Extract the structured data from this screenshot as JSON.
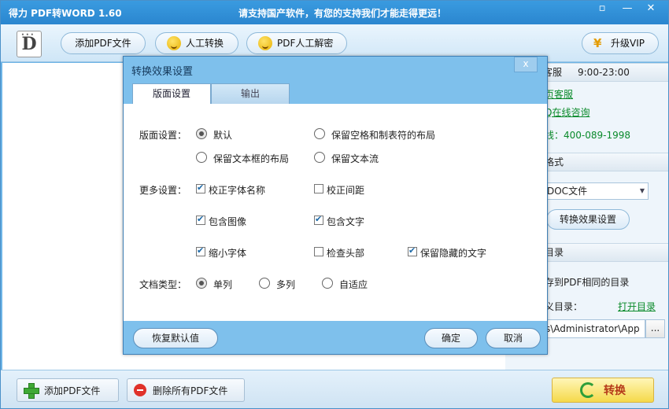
{
  "window": {
    "app_title": "得力 PDF转WORD 1.60",
    "slogan": "请支持国产软件，有您的支持我们才能走得更远！",
    "controls": [
      "▫",
      "—",
      "✕"
    ]
  },
  "toolbar": {
    "logo_letter": "D",
    "add_pdf_label": "添加PDF文件",
    "manual_convert_label": "人工转换",
    "pdf_decrypt_label": "PDF人工解密",
    "upgrade_vip_label": "升级VIP",
    "vip_icon": "¥"
  },
  "right_panel": {
    "service_label": "客服",
    "service_hours": "9:00-23:00",
    "web_service_link": "页客服",
    "qq_link": "Q在线咨询",
    "hotline": "线：400-089-1998",
    "format_header": "格式",
    "format_select": "DOC文件",
    "convert_settings_button": "转换效果设置",
    "dir_header": "目录",
    "save_same_dir": "存到PDF相同的目录",
    "custom_dir_label": "义目录：",
    "open_dir_link": "打开目录",
    "path_value": "s\\Administrator\\App",
    "browse_button": "..."
  },
  "bottom": {
    "add_pdf_label": "添加PDF文件",
    "delete_all_label": "删除所有PDF文件",
    "convert_label": "转换"
  },
  "dialog": {
    "title": "转换效果设置",
    "close": "x",
    "tabs": [
      {
        "label": "版面设置",
        "active": true
      },
      {
        "label": "输出",
        "active": false
      }
    ],
    "layout_label": "版面设置：",
    "layout_options": [
      {
        "label": "默认",
        "selected": true
      },
      {
        "label": "保留空格和制表符的布局",
        "selected": false
      },
      {
        "label": "保留文本框的布局",
        "selected": false
      },
      {
        "label": "保留文本流",
        "selected": false
      }
    ],
    "more_label": "更多设置：",
    "more_options": [
      {
        "label": "校正字体名称",
        "checked": true
      },
      {
        "label": "校正间距",
        "checked": false
      },
      {
        "label": "包含图像",
        "checked": true
      },
      {
        "label": "包含文字",
        "checked": true
      },
      {
        "label": "缩小字体",
        "checked": true
      },
      {
        "label": "检查头部",
        "checked": false
      },
      {
        "label": "保留隐藏的文字",
        "checked": true
      }
    ],
    "doctype_label": "文档类型：",
    "doctype_options": [
      {
        "label": "单列",
        "selected": true
      },
      {
        "label": "多列",
        "selected": false
      },
      {
        "label": "自适应",
        "selected": false
      }
    ],
    "restore_default": "恢复默认值",
    "ok": "确定",
    "cancel": "取消"
  },
  "colors": {
    "title_bar": "#2a86cf",
    "dialog_header": "#7ec0ec",
    "link_green": "#0a8a2a",
    "convert_text": "#b53a1a"
  }
}
